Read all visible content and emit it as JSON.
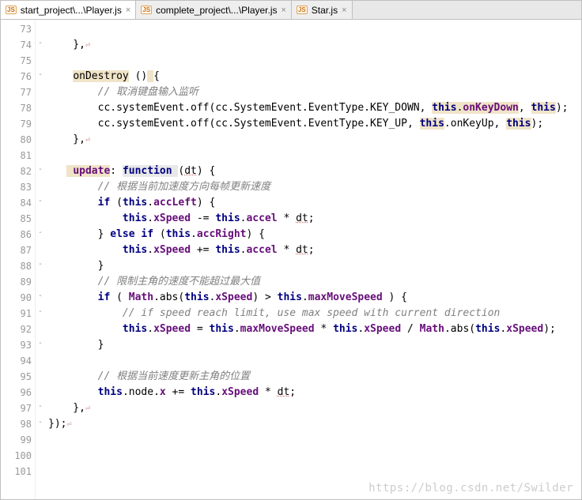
{
  "tabs": [
    {
      "icon": "JS",
      "label": "start_project\\...\\Player.js",
      "active": true
    },
    {
      "icon": "JS",
      "label": "complete_project\\...\\Player.js",
      "active": false
    },
    {
      "icon": "JS",
      "label": "Star.js",
      "active": false
    }
  ],
  "close_glyph": "×",
  "line_start": 73,
  "line_end": 101,
  "folds": {
    "74": "-",
    "76": "-",
    "82": "-",
    "84": "-",
    "86": "-",
    "88": "-",
    "90": "-",
    "91": "-",
    "93": "-",
    "97": "-",
    "98": "-"
  },
  "code": {
    "73": {
      "text": ""
    },
    "74": {
      "raw": "    },<span class='end-mark'>⏎</span>"
    },
    "75": {
      "text": ""
    },
    "76": {
      "raw": "    <span class='hl-k'>onDestroy</span> ()<span class='hl-k'> </span>{"
    },
    "77": {
      "raw": "        <span class='cm'>// 取消键盘输入监听</span>"
    },
    "78": {
      "raw": "        cc.systemEvent.off(cc.SystemEvent.EventType.KEY_DOWN, <span class='hl-k'><span class='kw'>this</span>.<span class='prop'>onKeyDown</span></span>, <span class='hl-k'><span class='kw'>this</span></span>);"
    },
    "79": {
      "raw": "        cc.systemEvent.off(cc.SystemEvent.EventType.KEY_UP, <span class='hl-k'><span class='kw'>this</span></span>.onKeyUp, <span class='hl-k'><span class='kw'>this</span></span>);"
    },
    "80": {
      "raw": "    },<span class='end-mark'>⏎</span>"
    },
    "81": {
      "text": ""
    },
    "82": {
      "raw": "   <span class='hl-k'> <span class='prop'>update</span></span>: <span class='hl-fn kw2'>function </span>(<span class='hl-warn'>dt</span>) {"
    },
    "83": {
      "raw": "        <span class='cm'>// 根据当前加速度方向每帧更新速度</span>"
    },
    "84": {
      "raw": "        <span class='kw'>if</span> (<span class='kw'>this</span>.<span class='prop'>accLeft</span>) {"
    },
    "85": {
      "raw": "            <span class='kw'>this</span>.<span class='prop'>xSpeed</span> -= <span class='kw'>this</span>.<span class='prop'>accel</span> * <span class='hl-warn'>dt</span>;"
    },
    "86": {
      "raw": "        } <span class='kw'>else if</span> (<span class='kw'>this</span>.<span class='prop'>accRight</span>) {"
    },
    "87": {
      "raw": "            <span class='kw'>this</span>.<span class='prop'>xSpeed</span> += <span class='kw'>this</span>.<span class='prop'>accel</span> * <span class='hl-warn'>dt</span>;"
    },
    "88": {
      "raw": "        }"
    },
    "89": {
      "raw": "        <span class='cm'>// 限制主角的速度不能超过最大值</span>"
    },
    "90": {
      "raw": "        <span class='kw'>if</span> ( <span class='prop'>Math</span>.<span class='fn'>abs</span>(<span class='kw'>this</span>.<span class='prop'>xSpeed</span>) &gt; <span class='kw'>this</span>.<span class='prop'>maxMoveSpeed</span> ) {"
    },
    "91": {
      "raw": "            <span class='cm'>// if speed reach limit, use max speed with current direction</span>"
    },
    "92": {
      "raw": "            <span class='kw'>this</span>.<span class='prop'>xSpeed</span> = <span class='kw'>this</span>.<span class='prop'>maxMoveSpeed</span> * <span class='kw'>this</span>.<span class='prop'>xSpeed</span> / <span class='prop'>Math</span>.abs(<span class='kw'>this</span>.<span class='prop'>xSpeed</span>);"
    },
    "93": {
      "raw": "        }"
    },
    "94": {
      "text": ""
    },
    "95": {
      "raw": "        <span class='cm'>// 根据当前速度更新主角的位置</span>"
    },
    "96": {
      "raw": "        <span class='kw'>this</span>.node.<span class='prop'>x</span> += <span class='kw'>this</span>.<span class='prop'>xSpeed</span> * <span class='hl-warn'>dt</span>;"
    },
    "97": {
      "raw": "    },<span class='end-mark'>⏎</span>"
    },
    "98": {
      "raw": "});<span class='end-mark'>⏎</span>"
    },
    "99": {
      "text": ""
    },
    "100": {
      "text": ""
    },
    "101": {
      "text": ""
    }
  },
  "watermark": "https://blog.csdn.net/Swilder"
}
